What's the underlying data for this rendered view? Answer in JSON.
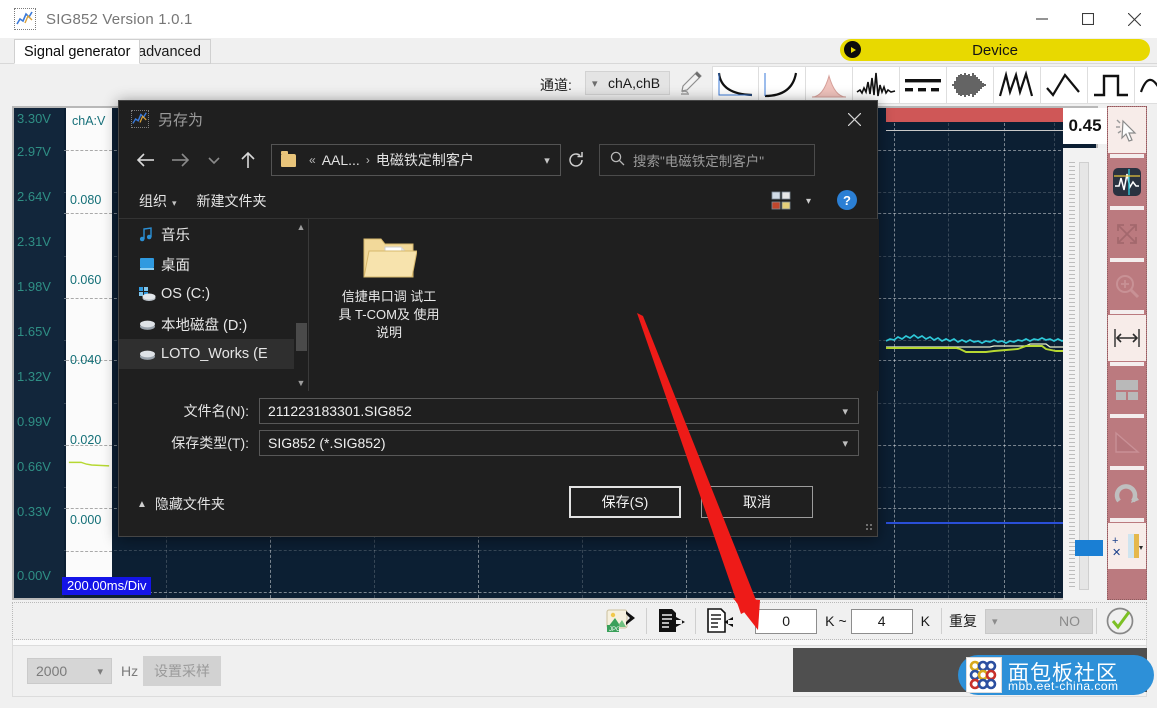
{
  "window": {
    "title": "SIG852  Version 1.0.1",
    "icon": "app-chart-icon",
    "minimize": "minimize-icon",
    "maximize": "maximize-icon",
    "close": "close-icon"
  },
  "tabs": [
    {
      "label": "Signal generator",
      "active": true
    },
    {
      "label": "advanced",
      "active": false
    }
  ],
  "device_pill": {
    "label": "Device",
    "color": "#e8d900"
  },
  "toolbar": {
    "channel_label": "通道:",
    "channel_value": "chA,chB",
    "pen_icon": "pen-icon",
    "wave_buttons": [
      "wave-decay-icon",
      "wave-rise-icon",
      "wave-gauss-icon",
      "wave-noise-spike-icon",
      "wave-dashed-dc-icon",
      "wave-am-burst-icon",
      "wave-sawtooth-icon",
      "wave-triangle-icon",
      "wave-square-icon",
      "wave-sine-icon"
    ]
  },
  "scope": {
    "voltage_labels": [
      "3.30V",
      "2.97V",
      "2.64V",
      "2.31V",
      "1.98V",
      "1.65V",
      "1.32V",
      "0.99V",
      "0.66V",
      "0.33V",
      "0.00V"
    ],
    "timebase": "200.00ms/Div",
    "channel_panel_title": "chA:V",
    "panel_values": [
      "0.080",
      "0.060",
      "0.040",
      "0.020",
      "0.000"
    ],
    "value_readout": "0.45",
    "trace_colors": {
      "chA": "#b6d832",
      "chB": "#2ec8d8",
      "marker_red": "#cf5757",
      "marker_blue": "#2a4fd8"
    }
  },
  "rail": {
    "items": [
      "cursor-pointer-icon",
      "waveform-measure-icon",
      "expand-arrows-icon",
      "zoom-in-icon",
      "horizontal-resize-icon",
      "window-layout-icon",
      "triangle-ruler-icon",
      "redo-arrow-icon",
      "add-remove-channel-icon"
    ]
  },
  "bottom_bar": {
    "icons": [
      "export-jpg-icon",
      "export-file-icon",
      "import-file-icon"
    ],
    "range_from": "0",
    "range_unit_from": "K",
    "range_sep": "~",
    "range_to": "4",
    "range_unit_to": "K",
    "repeat_label": "重复",
    "repeat_value": "NO",
    "confirm_icon": "check-circle-icon"
  },
  "footer": {
    "sample_rate": "2000",
    "hz_label": "Hz",
    "sample_button": "设置采样"
  },
  "watermark": {
    "title": "面包板社区",
    "url": "mbb.eet-china.com"
  },
  "dialog": {
    "title": "另存为",
    "close": "close-icon",
    "nav": {
      "back": "back-arrow-icon",
      "forward": "forward-arrow-icon",
      "recent": "chevron-down-icon",
      "up": "up-arrow-icon"
    },
    "address": {
      "folder_icon": "folder-icon",
      "crumb_sep": "«",
      "crumb1": "AAL...",
      "crumb_arrow": "›",
      "crumb2": "电磁铁定制客户",
      "dropdown": "chevron-down-icon",
      "refresh": "refresh-icon"
    },
    "search_placeholder": "搜索\"电磁铁定制客户\"",
    "commands": {
      "organize": "组织",
      "new_folder": "新建文件夹",
      "view_icon": "view-tiles-icon",
      "view_caret": "chevron-down-icon",
      "help": "?"
    },
    "nav_pane": [
      {
        "label": "音乐",
        "icon": "music-note-icon",
        "selected": false
      },
      {
        "label": "桌面",
        "icon": "desktop-icon",
        "selected": false
      },
      {
        "label": "OS (C:)",
        "icon": "os-drive-icon",
        "selected": false
      },
      {
        "label": "本地磁盘 (D:)",
        "icon": "drive-icon",
        "selected": false
      },
      {
        "label": "LOTO_Works (E",
        "icon": "drive-icon",
        "selected": true
      }
    ],
    "files": [
      {
        "name": "信捷串口调\n试工具\nT-COM及\n使用说明",
        "icon": "folder-pdf-icon"
      }
    ],
    "file_name_label": "文件名(N):",
    "file_name_value": "211223183301.SIG852",
    "save_type_label": "保存类型(T):",
    "save_type_value": "SIG852 (*.SIG852)",
    "hide_folders": "隐藏文件夹",
    "save_button": "保存(S)",
    "cancel_button": "取消"
  }
}
